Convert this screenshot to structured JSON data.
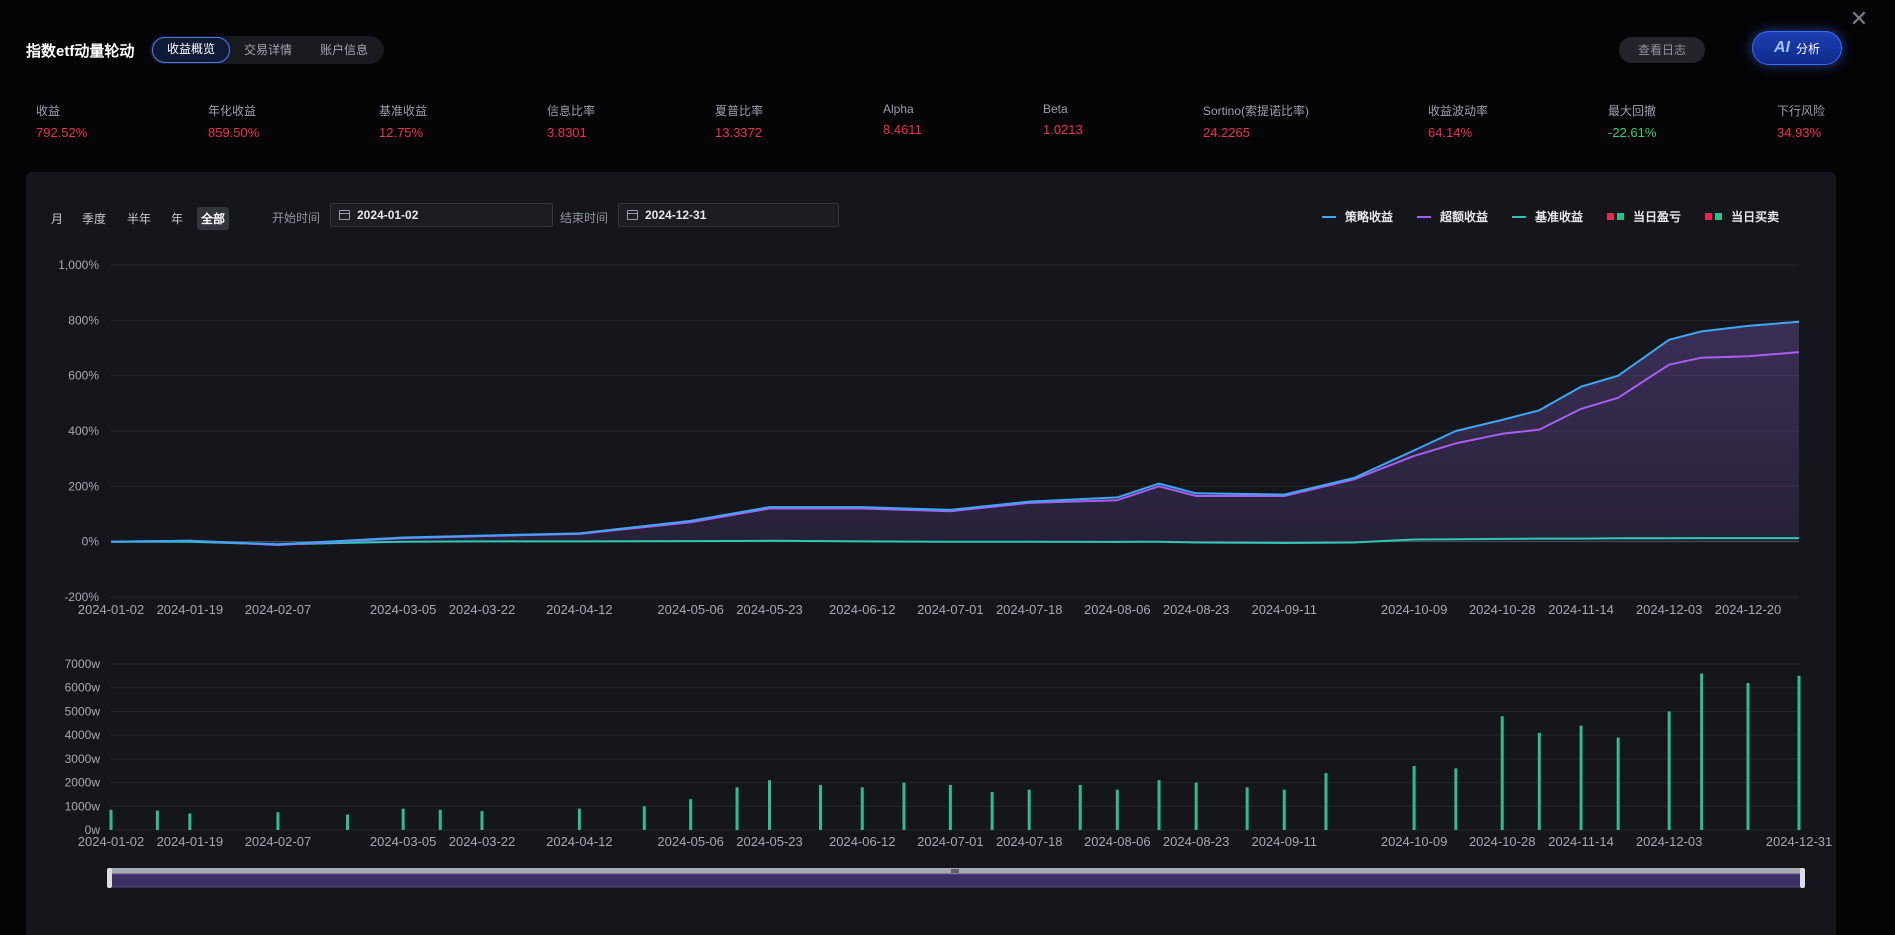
{
  "app": {
    "title": "指数etf动量轮动"
  },
  "tabs": [
    {
      "label": "收益概览",
      "active": true
    },
    {
      "label": "交易详情",
      "active": false
    },
    {
      "label": "账户信息",
      "active": false
    }
  ],
  "actions": {
    "log_label": "查看日志",
    "ai_mark": "AI",
    "ai_label": "分析",
    "close_icon": "close-icon"
  },
  "metrics": [
    {
      "label": "收益",
      "value": "792.52%",
      "tone": "red"
    },
    {
      "label": "年化收益",
      "value": "859.50%",
      "tone": "red"
    },
    {
      "label": "基准收益",
      "value": "12.75%",
      "tone": "red"
    },
    {
      "label": "信息比率",
      "value": "3.8301",
      "tone": "red"
    },
    {
      "label": "夏普比率",
      "value": "13.3372",
      "tone": "red"
    },
    {
      "label": "Alpha",
      "value": "8.4611",
      "tone": "red"
    },
    {
      "label": "Beta",
      "value": "1.0213",
      "tone": "red"
    },
    {
      "label": "Sortino(索提诺比率)",
      "value": "24.2265",
      "tone": "red"
    },
    {
      "label": "收益波动率",
      "value": "64.14%",
      "tone": "red"
    },
    {
      "label": "最大回撤",
      "value": "-22.61%",
      "tone": "green"
    },
    {
      "label": "下行风险",
      "value": "34.93%",
      "tone": "red"
    }
  ],
  "periods": [
    {
      "label": "月",
      "active": false
    },
    {
      "label": "季度",
      "active": false
    },
    {
      "label": "半年",
      "active": false
    },
    {
      "label": "年",
      "active": false
    },
    {
      "label": "全部",
      "active": true
    }
  ],
  "date_range": {
    "start_label": "开始时间",
    "start_value": "2024-01-02",
    "end_label": "结束时间",
    "end_value": "2024-12-31"
  },
  "colors": {
    "strategy": "#3da6f5",
    "excess": "#a65ff2",
    "benchmark": "#2fc7b8",
    "profit": "#e32751",
    "loss": "#2dbd8e",
    "area_top": "#5b4287"
  },
  "legend": [
    {
      "label": "策略收益",
      "kind": "line",
      "color": "#3da6f5"
    },
    {
      "label": "超额收益",
      "kind": "line",
      "color": "#a65ff2"
    },
    {
      "label": "基准收益",
      "kind": "line",
      "color": "#2fc7b8"
    },
    {
      "label": "当日盈亏",
      "kind": "bar",
      "colors": [
        "#e32751",
        "#2dbd8e"
      ]
    },
    {
      "label": "当日买卖",
      "kind": "bar",
      "colors": [
        "#e32751",
        "#2dbd8e"
      ]
    }
  ],
  "chart_data": [
    {
      "type": "line",
      "ylim": [
        -200,
        1000
      ],
      "y_ticks": [
        -200,
        0,
        200,
        400,
        600,
        800,
        1000
      ],
      "y_tick_labels": [
        "-200%",
        "0%",
        "200%",
        "400%",
        "600%",
        "800%",
        "1,000%"
      ],
      "x_ticks": [
        "2024-01-02",
        "2024-01-19",
        "2024-02-07",
        "2024-03-05",
        "2024-03-22",
        "2024-04-12",
        "2024-05-06",
        "2024-05-23",
        "2024-06-12",
        "2024-07-01",
        "2024-07-18",
        "2024-08-06",
        "2024-08-23",
        "2024-09-11",
        "2024-10-09",
        "2024-10-28",
        "2024-11-14",
        "2024-12-03",
        "2024-12-20"
      ],
      "x": [
        "2024-01-02",
        "2024-01-19",
        "2024-02-07",
        "2024-03-05",
        "2024-03-22",
        "2024-04-12",
        "2024-05-06",
        "2024-05-23",
        "2024-06-12",
        "2024-07-01",
        "2024-07-18",
        "2024-08-06",
        "2024-08-15",
        "2024-08-23",
        "2024-09-11",
        "2024-09-26",
        "2024-10-09",
        "2024-10-18",
        "2024-10-28",
        "2024-11-05",
        "2024-11-14",
        "2024-11-22",
        "2024-12-03",
        "2024-12-10",
        "2024-12-20",
        "2024-12-31"
      ],
      "series": [
        {
          "name": "策略收益",
          "values": [
            0,
            3,
            -10,
            15,
            22,
            30,
            75,
            125,
            125,
            115,
            145,
            160,
            210,
            175,
            170,
            230,
            330,
            400,
            440,
            475,
            560,
            600,
            730,
            760,
            780,
            795
          ]
        },
        {
          "name": "超额收益",
          "values": [
            0,
            3,
            -12,
            13,
            20,
            28,
            70,
            120,
            120,
            110,
            140,
            150,
            200,
            165,
            165,
            225,
            310,
            355,
            390,
            405,
            480,
            520,
            640,
            665,
            670,
            685
          ]
        },
        {
          "name": "基准收益",
          "values": [
            0,
            0,
            -10,
            0,
            1,
            1,
            2,
            3,
            1,
            0,
            0,
            -1,
            0,
            -3,
            -5,
            -3,
            8,
            9,
            10,
            11,
            11,
            12,
            12,
            13,
            13,
            13
          ]
        }
      ],
      "grid": true,
      "legend_position": "top-right"
    },
    {
      "type": "bar",
      "ylim": [
        0,
        7000
      ],
      "y_ticks": [
        0,
        1000,
        2000,
        3000,
        4000,
        5000,
        6000,
        7000
      ],
      "y_tick_labels": [
        "0w",
        "1000w",
        "2000w",
        "3000w",
        "4000w",
        "5000w",
        "6000w",
        "7000w"
      ],
      "x_ticks": [
        "2024-01-02",
        "2024-01-19",
        "2024-02-07",
        "2024-03-05",
        "2024-03-22",
        "2024-04-12",
        "2024-05-06",
        "2024-05-23",
        "2024-06-12",
        "2024-07-01",
        "2024-07-18",
        "2024-08-06",
        "2024-08-23",
        "2024-09-11",
        "2024-10-09",
        "2024-10-28",
        "2024-11-14",
        "2024-12-03",
        "2024-12-31"
      ],
      "x": [
        "2024-01-02",
        "2024-01-12",
        "2024-01-19",
        "2024-02-07",
        "2024-02-22",
        "2024-03-05",
        "2024-03-13",
        "2024-03-22",
        "2024-04-12",
        "2024-04-26",
        "2024-05-06",
        "2024-05-16",
        "2024-05-23",
        "2024-06-03",
        "2024-06-12",
        "2024-06-21",
        "2024-07-01",
        "2024-07-10",
        "2024-07-18",
        "2024-07-29",
        "2024-08-06",
        "2024-08-15",
        "2024-08-23",
        "2024-09-03",
        "2024-09-11",
        "2024-09-20",
        "2024-10-09",
        "2024-10-18",
        "2024-10-28",
        "2024-11-05",
        "2024-11-14",
        "2024-11-22",
        "2024-12-03",
        "2024-12-10",
        "2024-12-20",
        "2024-12-31"
      ],
      "values": [
        850,
        820,
        700,
        750,
        650,
        900,
        850,
        800,
        900,
        1000,
        1300,
        1800,
        2100,
        1900,
        1800,
        2000,
        1900,
        1600,
        1700,
        1900,
        1700,
        2100,
        2000,
        1800,
        1700,
        2400,
        2700,
        2600,
        4800,
        4100,
        4400,
        3900,
        5000,
        6600,
        6200,
        6500
      ],
      "grid": true
    }
  ]
}
